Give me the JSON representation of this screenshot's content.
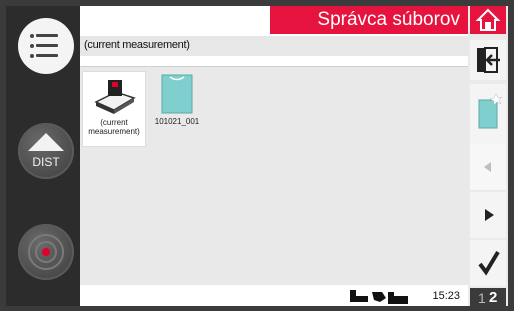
{
  "header": {
    "title": "Správca súborov"
  },
  "path": {
    "current": "(current measurement)"
  },
  "left_panel": {
    "dist_label": "DIST"
  },
  "files": [
    {
      "name": "(current measurement)",
      "selected": true,
      "icon": "current-measurement-icon"
    },
    {
      "name": "101021_001",
      "selected": false,
      "icon": "file-folder-icon"
    }
  ],
  "status": {
    "time": "15:23"
  },
  "pages": {
    "page1": "1",
    "page2": "2"
  },
  "colors": {
    "accent": "#e5133d",
    "folder": "#7fcfcf"
  }
}
